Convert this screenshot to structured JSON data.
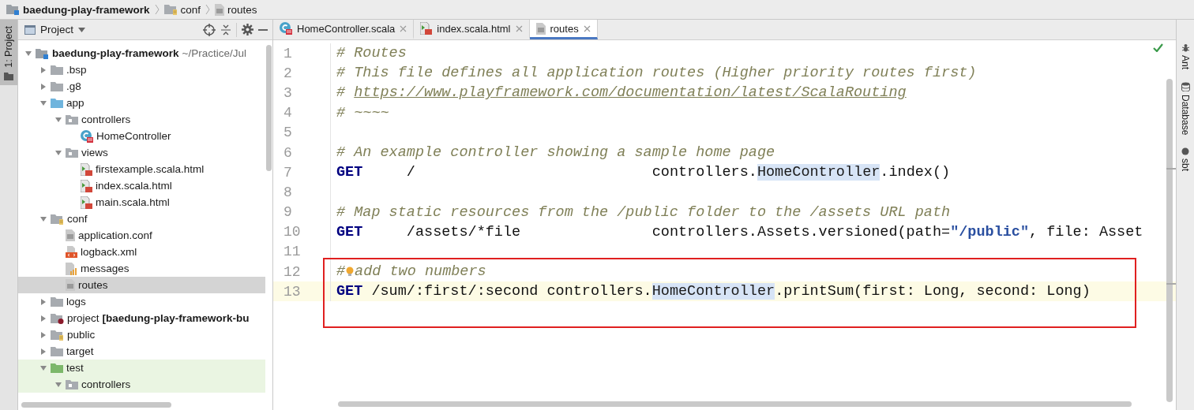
{
  "breadcrumbs": [
    {
      "label": "baedung-play-framework",
      "kind": "module"
    },
    {
      "label": "conf",
      "kind": "resources"
    },
    {
      "label": "routes",
      "kind": "text"
    }
  ],
  "left_strip": {
    "tab": "1: Project"
  },
  "project_panel": {
    "title": "Project"
  },
  "tree": [
    {
      "name": "baedung-play-framework",
      "kind": "module",
      "path": "~/Practice/Jul",
      "expanded": true,
      "selected": false,
      "tinted": false,
      "children": [
        {
          "name": ".bsp",
          "kind": "folder",
          "expanded": false,
          "selected": false,
          "tinted": false
        },
        {
          "name": ".g8",
          "kind": "folder",
          "expanded": false,
          "selected": false,
          "tinted": false
        },
        {
          "name": "app",
          "kind": "source",
          "expanded": true,
          "selected": false,
          "tinted": false,
          "children": [
            {
              "name": "controllers",
              "kind": "package",
              "expanded": true,
              "selected": false,
              "tinted": false,
              "children": [
                {
                  "name": "HomeController",
                  "kind": "scala-class",
                  "selected": false,
                  "tinted": false
                }
              ]
            },
            {
              "name": "views",
              "kind": "package",
              "expanded": true,
              "selected": false,
              "tinted": false,
              "children": [
                {
                  "name": "firstexample.scala.html",
                  "kind": "html",
                  "selected": false,
                  "tinted": false
                },
                {
                  "name": "index.scala.html",
                  "kind": "html",
                  "selected": false,
                  "tinted": false
                },
                {
                  "name": "main.scala.html",
                  "kind": "html",
                  "selected": false,
                  "tinted": false
                }
              ]
            }
          ]
        },
        {
          "name": "conf",
          "kind": "resources",
          "expanded": true,
          "selected": false,
          "tinted": false,
          "children": [
            {
              "name": "application.conf",
              "kind": "text",
              "selected": false,
              "tinted": false
            },
            {
              "name": "logback.xml",
              "kind": "xml",
              "selected": false,
              "tinted": false
            },
            {
              "name": "messages",
              "kind": "properties",
              "selected": false,
              "tinted": false
            },
            {
              "name": "routes",
              "kind": "text",
              "selected": true,
              "tinted": false
            }
          ]
        },
        {
          "name": "logs",
          "kind": "folder",
          "expanded": false,
          "selected": false,
          "tinted": false
        },
        {
          "name": "project",
          "kind": "project-module",
          "module_name": "[baedung-play-framework-bu",
          "expanded": false,
          "selected": false,
          "tinted": false
        },
        {
          "name": "public",
          "kind": "resources",
          "expanded": false,
          "selected": false,
          "tinted": false
        },
        {
          "name": "target",
          "kind": "folder",
          "expanded": false,
          "selected": false,
          "tinted": false
        },
        {
          "name": "test",
          "kind": "test",
          "expanded": true,
          "selected": false,
          "tinted": true,
          "children": [
            {
              "name": "controllers",
              "kind": "package",
              "expanded": true,
              "selected": false,
              "tinted": true
            }
          ]
        }
      ]
    }
  ],
  "tabs": [
    {
      "label": "HomeController.scala",
      "kind": "scala-class",
      "selected": false
    },
    {
      "label": "index.scala.html",
      "kind": "html",
      "selected": false
    },
    {
      "label": "routes",
      "kind": "text",
      "selected": true
    }
  ],
  "lines": [
    {
      "number": "1",
      "current": false,
      "boxed": false,
      "segments": [
        {
          "kind": "comment",
          "text": "# Routes"
        }
      ]
    },
    {
      "number": "2",
      "current": false,
      "boxed": false,
      "segments": [
        {
          "kind": "comment",
          "text": "# This file defines all application routes (Higher priority routes first)"
        }
      ]
    },
    {
      "number": "3",
      "current": false,
      "boxed": false,
      "segments": [
        {
          "kind": "comment",
          "text": "# "
        },
        {
          "kind": "link",
          "text": "https://www.playframework.com/documentation/latest/ScalaRouting"
        }
      ]
    },
    {
      "number": "4",
      "current": false,
      "boxed": false,
      "segments": [
        {
          "kind": "comment",
          "text": "# ~~~~"
        }
      ]
    },
    {
      "number": "5",
      "current": false,
      "boxed": false
    },
    {
      "number": "6",
      "current": false,
      "boxed": false,
      "segments": [
        {
          "kind": "comment",
          "text": "# An example controller showing a sample home page"
        }
      ]
    },
    {
      "number": "7",
      "current": false,
      "boxed": false,
      "segments": [
        {
          "kind": "keyword",
          "text": "GET"
        },
        {
          "kind": "plain",
          "text": "     /                           controllers."
        },
        {
          "kind": "highlight",
          "text": "HomeController"
        },
        {
          "kind": "plain",
          "text": ".index()"
        }
      ]
    },
    {
      "number": "8",
      "current": false,
      "boxed": false
    },
    {
      "number": "9",
      "current": false,
      "boxed": false,
      "segments": [
        {
          "kind": "comment",
          "text": "# Map static resources from the /public folder to the /assets URL path"
        }
      ]
    },
    {
      "number": "10",
      "current": false,
      "boxed": false,
      "segments": [
        {
          "kind": "keyword",
          "text": "GET"
        },
        {
          "kind": "plain",
          "text": "     /assets/*file               controllers.Assets.versioned(path="
        },
        {
          "kind": "string",
          "text": "\"/public\""
        },
        {
          "kind": "plain",
          "text": ", file: Asset"
        }
      ]
    },
    {
      "number": "11",
      "current": false,
      "boxed": false
    },
    {
      "number": "12",
      "current": false,
      "boxed": true,
      "segments": [
        {
          "kind": "comment",
          "text": "#"
        },
        {
          "kind": "bulb"
        },
        {
          "kind": "comment",
          "text": "add two numbers"
        }
      ]
    },
    {
      "number": "13",
      "current": true,
      "boxed": true,
      "segments": [
        {
          "kind": "keyword",
          "text": "GET"
        },
        {
          "kind": "plain",
          "text": " /sum/:first/:second controllers."
        },
        {
          "kind": "highlight",
          "text": "HomeController"
        },
        {
          "kind": "plain",
          "text": ".printSum(first: Long, second: Long)"
        }
      ]
    }
  ],
  "right_strip": [
    {
      "label": "Ant",
      "kind": "ant"
    },
    {
      "label": "Database",
      "kind": "database"
    },
    {
      "label": "sbt",
      "kind": "sbt"
    }
  ]
}
